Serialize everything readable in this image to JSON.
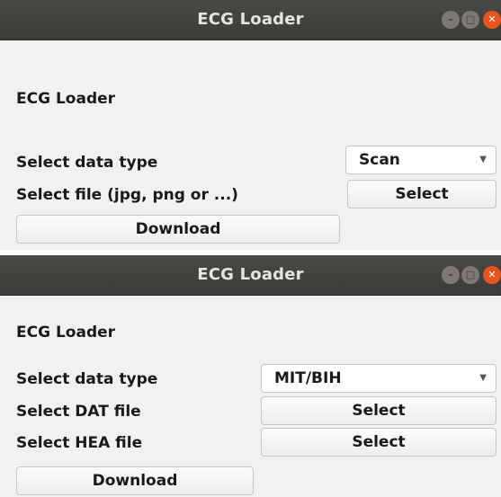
{
  "window1": {
    "title": "ECG Loader",
    "heading": "ECG Loader",
    "data_type_label": "Select data type",
    "data_type_value": "Scan",
    "file_label": "Select file (jpg, png or ...)",
    "select_button": "Select",
    "download_button": "Download"
  },
  "window2": {
    "title": "ECG Loader",
    "heading": "ECG Loader",
    "data_type_label": "Select data type",
    "data_type_value": "MIT/BIH",
    "dat_label": "Select DAT file",
    "dat_button": "Select",
    "hea_label": "Select HEA file",
    "hea_button": "Select",
    "download_button": "Download"
  },
  "icons": {
    "minimize": "minimize-icon",
    "maximize": "maximize-icon",
    "close": "close-icon",
    "dropdown": "chevron-down-icon"
  },
  "colors": {
    "titlebar": "#3c3b37",
    "window_bg": "#f2f1f0",
    "close_button": "#e95420"
  }
}
